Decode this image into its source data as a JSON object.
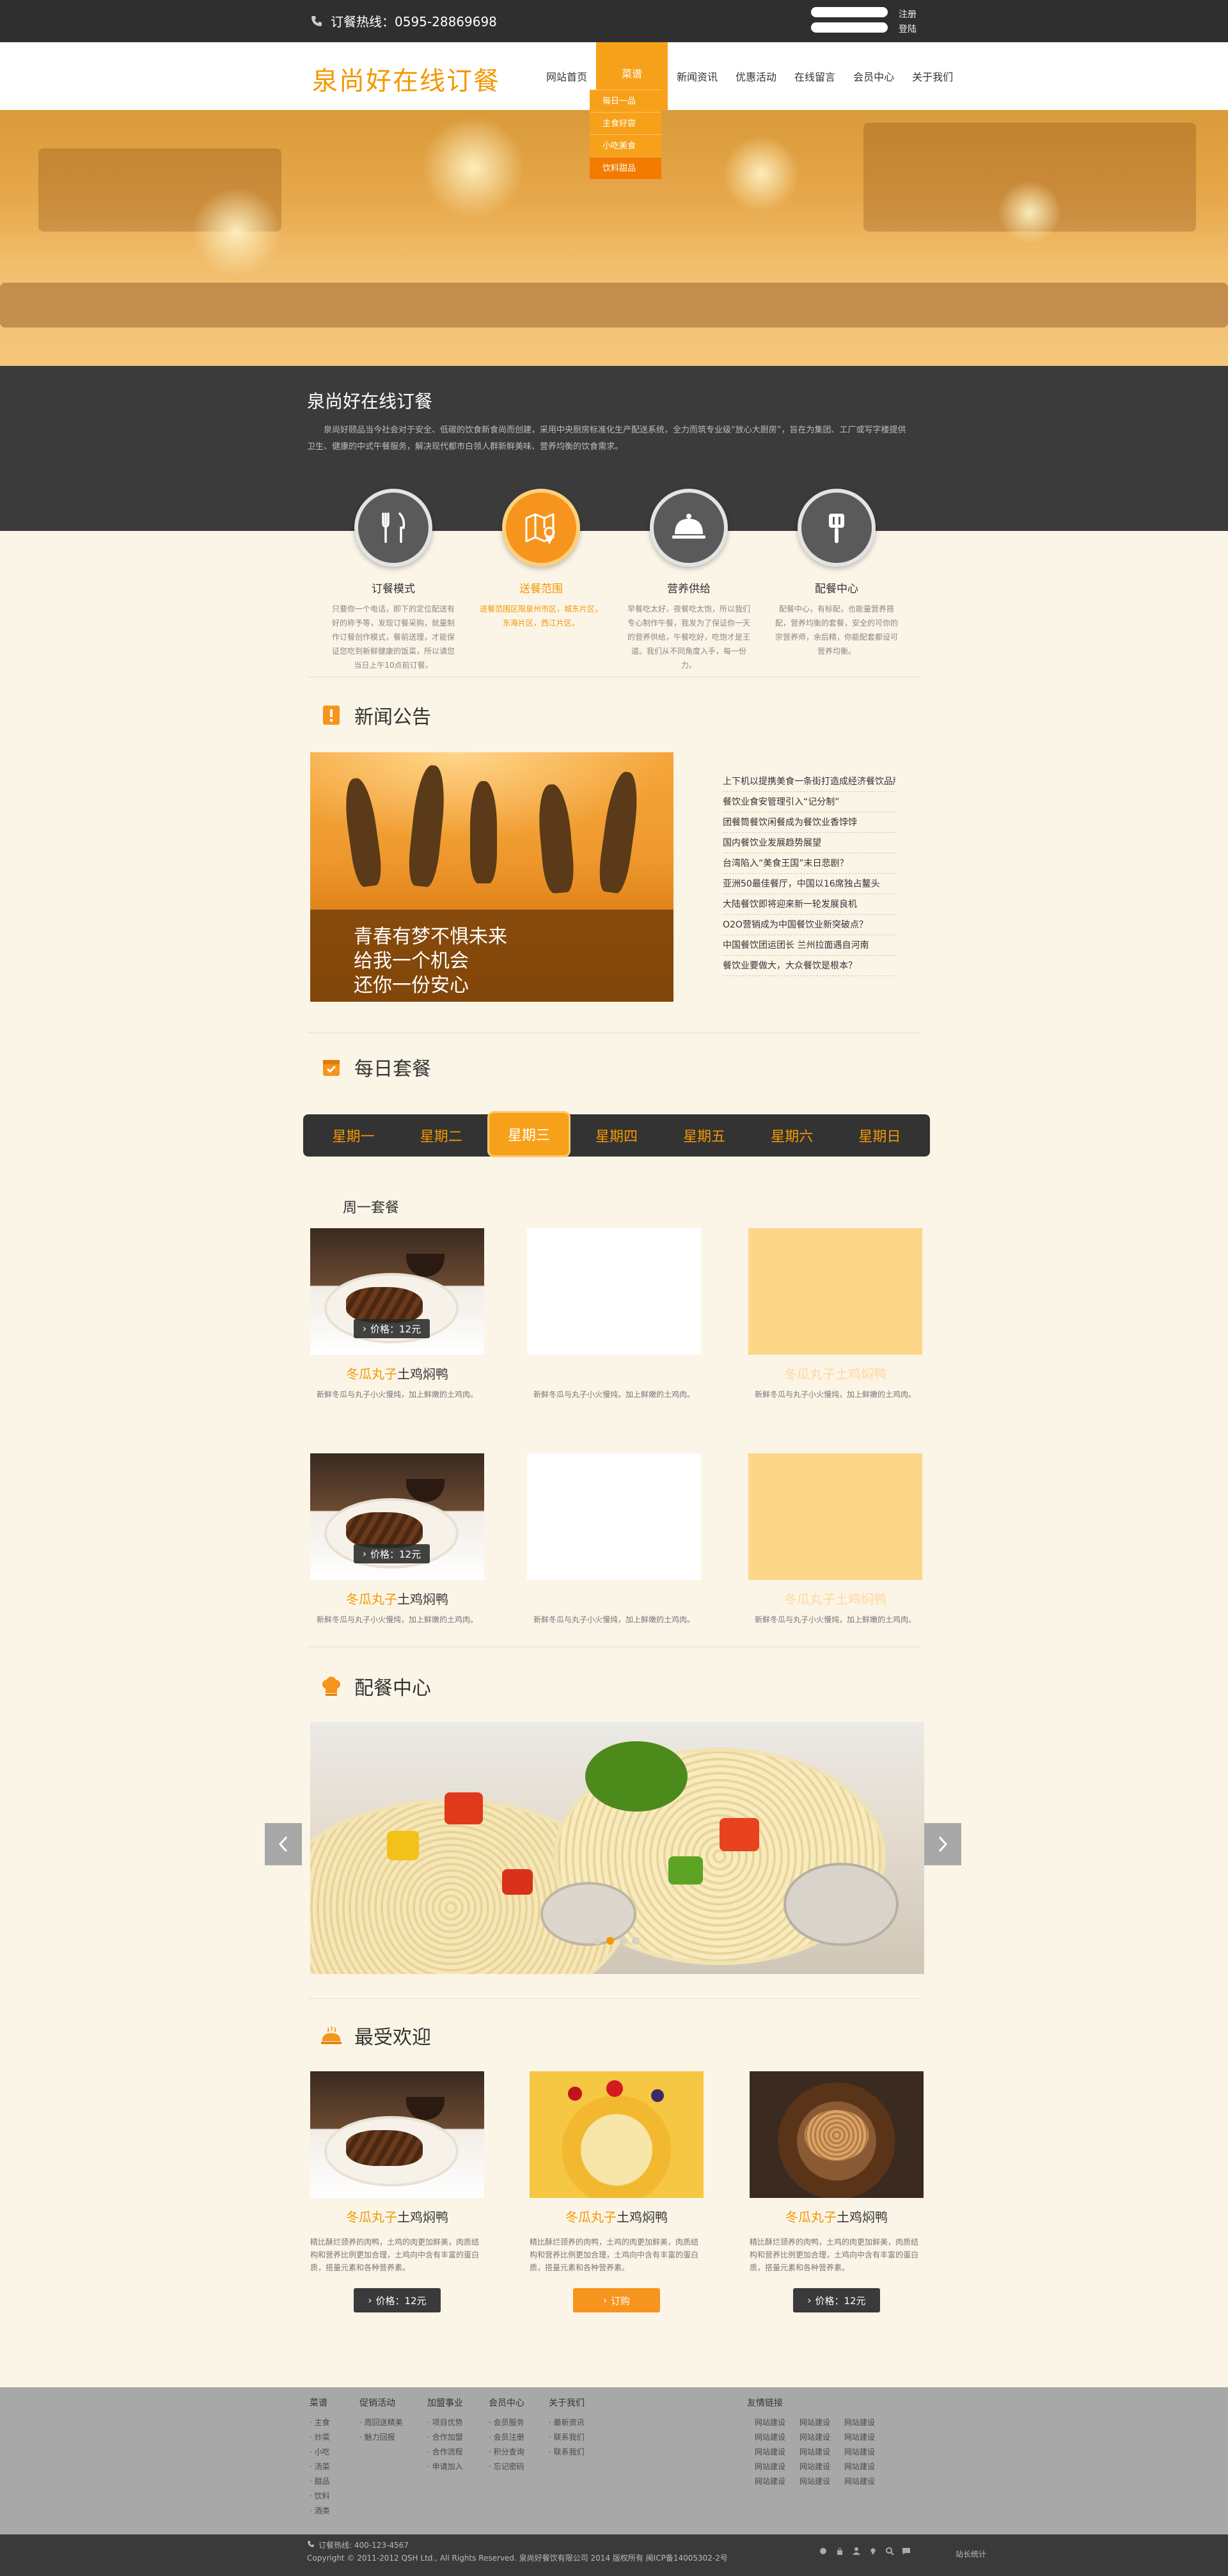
{
  "topbar": {
    "hotline": "订餐热线：0595-28869698",
    "register": "注册",
    "login": "登陆"
  },
  "header": {
    "logo": "泉尚好在线订餐",
    "nav": [
      "网站首页",
      "菜谱",
      "新闻资讯",
      "优惠活动",
      "在线留言",
      "会员中心",
      "关于我们"
    ],
    "dropdown": [
      "每日一品",
      "主食好尝",
      "小吃美食",
      "饮料甜品"
    ]
  },
  "intro": {
    "title": "泉尚好在线订餐",
    "text": "泉尚好颐品当今社会对于安全、低碳的饮食新食尚而创建，采用中央厨房标准化生产配送系统，全力而筑专业级“放心大厨房”，旨在为集团、工厂或写字楼提供卫生、健康的中式午餐服务，解决现代都市白领人群新鲜美味、营养均衡的饮食需求。"
  },
  "features": [
    {
      "title": "订餐模式",
      "desc": "只要你一个电话，即下的定位配送有好的称予等，发现订餐采购，就量制作订餐创作模式，餐前送理，才能保证您吃到新鲜健康的饭菜，所以请您当日上午10点前订餐。",
      "icon": "fork-knife-icon"
    },
    {
      "title": "送餐范围",
      "desc": "送餐范围区限泉州市区，城东片区，东海片区，西江片区。",
      "icon": "map-pin-icon"
    },
    {
      "title": "营养供给",
      "desc": "早餐吃太好，夜餐吃太饱，所以我们专心制作午餐，我发为了保证你一天的营养供给，午餐吃好，吃饱才是王道。我们从不同角度入手，每一份力。",
      "icon": "food-cover-icon"
    },
    {
      "title": "配餐中心",
      "desc": "配餐中心，有标配，也能量营养搭配，营养均衡的套餐，安全的可你的宗营养师，余后精，你能配套都设可营养均衡。",
      "icon": "spatula-icon"
    }
  ],
  "news": {
    "title": "新闻公告",
    "caption": [
      "青春有梦不惧未来",
      "给我一个机会",
      "还你一份安心"
    ],
    "items": [
      "上下机以提携美食一条街打造成经济餐饮品牌",
      "餐饮业食安管理引入“记分制”",
      "团餐筒餐饮闲餐成为餐饮业香饽饽",
      "国内餐饮业发展趋势展望",
      "台湾陷入“美食王国”末日悲剧？",
      "亚洲50最佳餐厅，中国以16席独占鳌头",
      "大陆餐饮即将迎来新一轮发展良机",
      "O2O营销成为中国餐饮业新突破点？",
      "中国餐饮团运团长 兰州拉面遇自河南",
      "餐饮业要做大，大众餐饮是根本？"
    ]
  },
  "daily": {
    "title": "每日套餐",
    "tabs": [
      "星期一",
      "星期二",
      "星期三",
      "星期四",
      "星期五",
      "星期六",
      "星期日"
    ],
    "set_title": "周一套餐",
    "dish_name_a": "冬瓜丸子",
    "dish_name_b": "土鸡焖鸭",
    "dish_desc": "新鲜冬瓜与丸子小火慢炖，加上鲜嫩的土鸡肉。",
    "price": "价格：12元"
  },
  "pei": {
    "title": "配餐中心"
  },
  "popular": {
    "title": "最受欢迎",
    "name_a": "冬瓜丸子",
    "name_b": "土鸡焖鸭",
    "desc": "精比酥烂颈养的肉鸭，土鸡的肉更加鲜美，肉质结构和营养比例更加合理，土鸡向中含有丰富的蛋白质，搭量元素和各种营养素。",
    "buttons": [
      "价格：12元",
      "订购",
      "价格：12元"
    ]
  },
  "footer": {
    "columns": [
      {
        "head": "菜谱",
        "links": [
          "主食",
          "炒菜",
          "小吃",
          "汤菜",
          "甜品",
          "饮料",
          "酒类"
        ]
      },
      {
        "head": "促销活动",
        "links": [
          "周回送精美",
          "魅力回报"
        ]
      },
      {
        "head": "加盟事业",
        "links": [
          "项目优势",
          "合作加盟",
          "合作流程",
          "申请加入"
        ]
      },
      {
        "head": "会员中心",
        "links": [
          "会员服务",
          "会员注册",
          "积分查询",
          "忘记密码"
        ]
      },
      {
        "head": "关于我们",
        "links": [
          "最新资讯",
          "联系我们",
          "联系我们"
        ]
      }
    ],
    "friend_head": "友情链接",
    "friend_link": "网站建设",
    "hotline": "订餐热线: 400-123-4567",
    "copyright": "Copyright © 2011-2012 QSH Ltd.,  All Rights Reserved.   泉尚好餐饮有限公司 2014 版权所有 闽ICP备14005302-2号",
    "stats": "站长统计"
  }
}
